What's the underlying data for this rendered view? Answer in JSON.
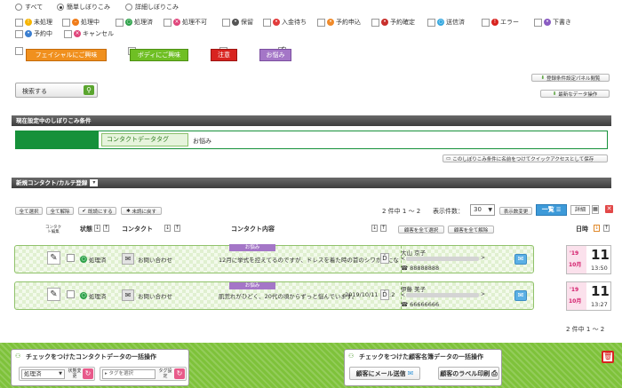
{
  "mode": {
    "all": "すべて",
    "simple": "簡単しぼりこみ",
    "detail": "詳細しぼりこみ"
  },
  "statuses": [
    "未処理",
    "処理中",
    "処理済",
    "処理不可",
    "保留",
    "入金待ち",
    "予約申込",
    "予約確定",
    "送信済",
    "エラー",
    "下書き",
    "予約中",
    "キャンセル"
  ],
  "tags": [
    "フェイシャルにご興味",
    "ボディにご興味",
    "注意",
    "お悩み"
  ],
  "colors": {
    "facial": "#f0901e",
    "body": "#6fbf24",
    "caution": "#d8231f",
    "worries": "#a476c7",
    "header": "#4a4a4a",
    "greenbar": "#16913a"
  },
  "search_label": "検索する",
  "right_buttons": {
    "panel": "登録条件設定パネル閲覧",
    "data": "最新なデータ操作"
  },
  "condition": {
    "title": "現在設定中のしぼりこみ条件",
    "key": "コンタクトデータタグ",
    "value": "お悩み",
    "save": "このしぼりこみ条件に名前をつけてクイックアクセスとして保存"
  },
  "list": {
    "title": "新規コンタクト/カルテ登録",
    "select_all": "全て選択",
    "deselect_all": "全て解除",
    "mark_read": "既読にする",
    "mark_unread": "未読に戻す",
    "count": "2 件中 1 ～ 2",
    "display_label": "表示件数：",
    "display_value": "30",
    "show_all": "表示数変更",
    "view_list": "一覧",
    "view_detail": "詳細",
    "footer_count": "2 件中 1 ～ 2"
  },
  "headers": {
    "edit": "コンタクト編集",
    "status": "状態",
    "contact": "コンタクト",
    "content": "コンタクト内容",
    "select_all": "顧客を全て選択",
    "deselect_all": "顧客を全て解除",
    "date": "日時"
  },
  "rows": [
    {
      "status": "処理済",
      "type": "お問い合わせ",
      "tag": "お悩み",
      "content": "12月に挙式を控えてるのですが、ドレスを着た時の首のシワが気にな",
      "date_text": "",
      "name": "大山 京子",
      "email": "<",
      "phone": "88888888",
      "yr": "'19",
      "mo": "10月",
      "day": "11",
      "time": "13:50"
    },
    {
      "status": "処理済",
      "type": "お問い合わせ",
      "tag": "お悩み",
      "content": "肌荒れがひどく、20代の頃からずっと悩んでいます。",
      "date_text": "2019/10/11 ",
      "name": "伊藤 美子",
      "email": "<",
      "phone": "66666666",
      "yr": "'19",
      "mo": "10月",
      "day": "11",
      "time": "13:27"
    }
  ],
  "footer": {
    "contact_title": "チェックをつけたコンタクトデータの一括操作",
    "status_value": "処理済",
    "status_change": "状態変更",
    "tag_placeholder": "タグを選択",
    "tag_set": "タグ設定",
    "customer_title": "チェックをつけた顧客名簿データの一括操作",
    "mail": "顧客にメール送信",
    "label_print": "顧客のラベル印刷"
  }
}
